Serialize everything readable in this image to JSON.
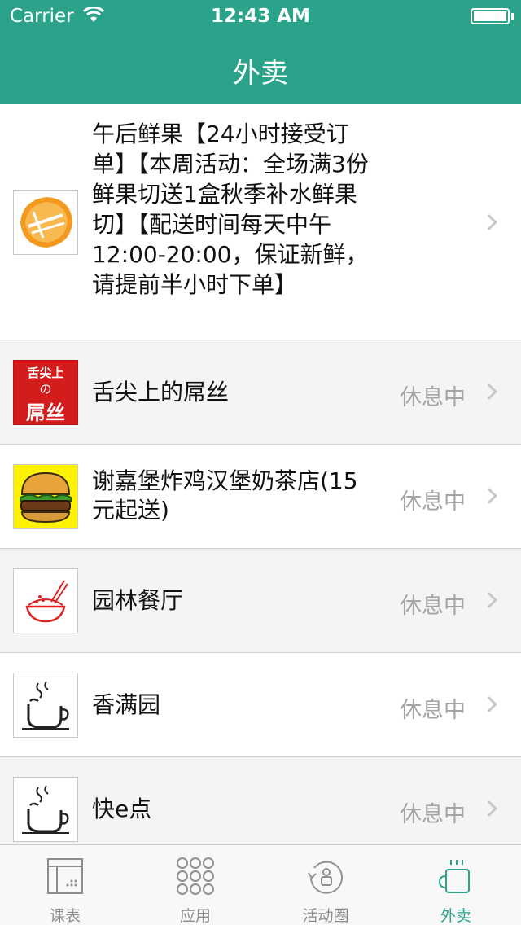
{
  "status_bar": {
    "carrier": "Carrier",
    "time": "12:43 AM"
  },
  "nav": {
    "title": "外卖"
  },
  "restaurants": [
    {
      "name": "午后鲜果【24小时接受订单】【本周活动：全场满3份鲜果切送1盒秋季补水鲜果切】【配送时间每天中午12:00-20:00，保证新鲜，请提前半小时下单】",
      "status": ""
    },
    {
      "name": "舌尖上的屌丝",
      "status": "休息中",
      "logo_text_top": "舌尖上",
      "logo_text_mid": "の",
      "logo_text_bottom": "屌丝"
    },
    {
      "name": " 谢嘉堡炸鸡汉堡奶茶店(15元起送)",
      "status": "休息中"
    },
    {
      "name": "园林餐厅",
      "status": "休息中"
    },
    {
      "name": "香满园",
      "status": "休息中"
    },
    {
      "name": "快e点",
      "status": "休息中"
    }
  ],
  "tabs": [
    {
      "label": "课表",
      "icon": "schedule-icon"
    },
    {
      "label": "应用",
      "icon": "apps-grid-icon"
    },
    {
      "label": "活动圈",
      "icon": "activity-circle-icon"
    },
    {
      "label": "外卖",
      "icon": "coffee-cup-icon"
    }
  ],
  "colors": {
    "accent": "#2aa38a",
    "status_gray": "#a5a5a5"
  }
}
